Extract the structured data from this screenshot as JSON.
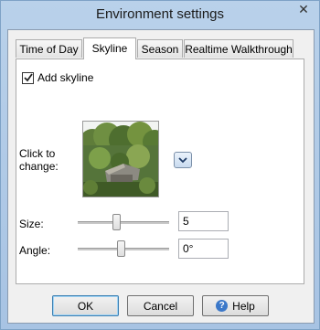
{
  "window": {
    "title": "Environment settings",
    "close_symbol": "✕"
  },
  "tabs": [
    {
      "label": "Time of Day"
    },
    {
      "label": "Skyline"
    },
    {
      "label": "Season"
    },
    {
      "label": "Realtime Walkthrough"
    }
  ],
  "active_tab": "Skyline",
  "skyline": {
    "add_skyline_label": "Add skyline",
    "add_skyline_checked": true,
    "click_to_change_label": "Click to change:",
    "size_label": "Size:",
    "size_value": "5",
    "angle_label": "Angle:",
    "angle_value": "0°"
  },
  "buttons": {
    "ok": "OK",
    "cancel": "Cancel",
    "help": "Help"
  }
}
